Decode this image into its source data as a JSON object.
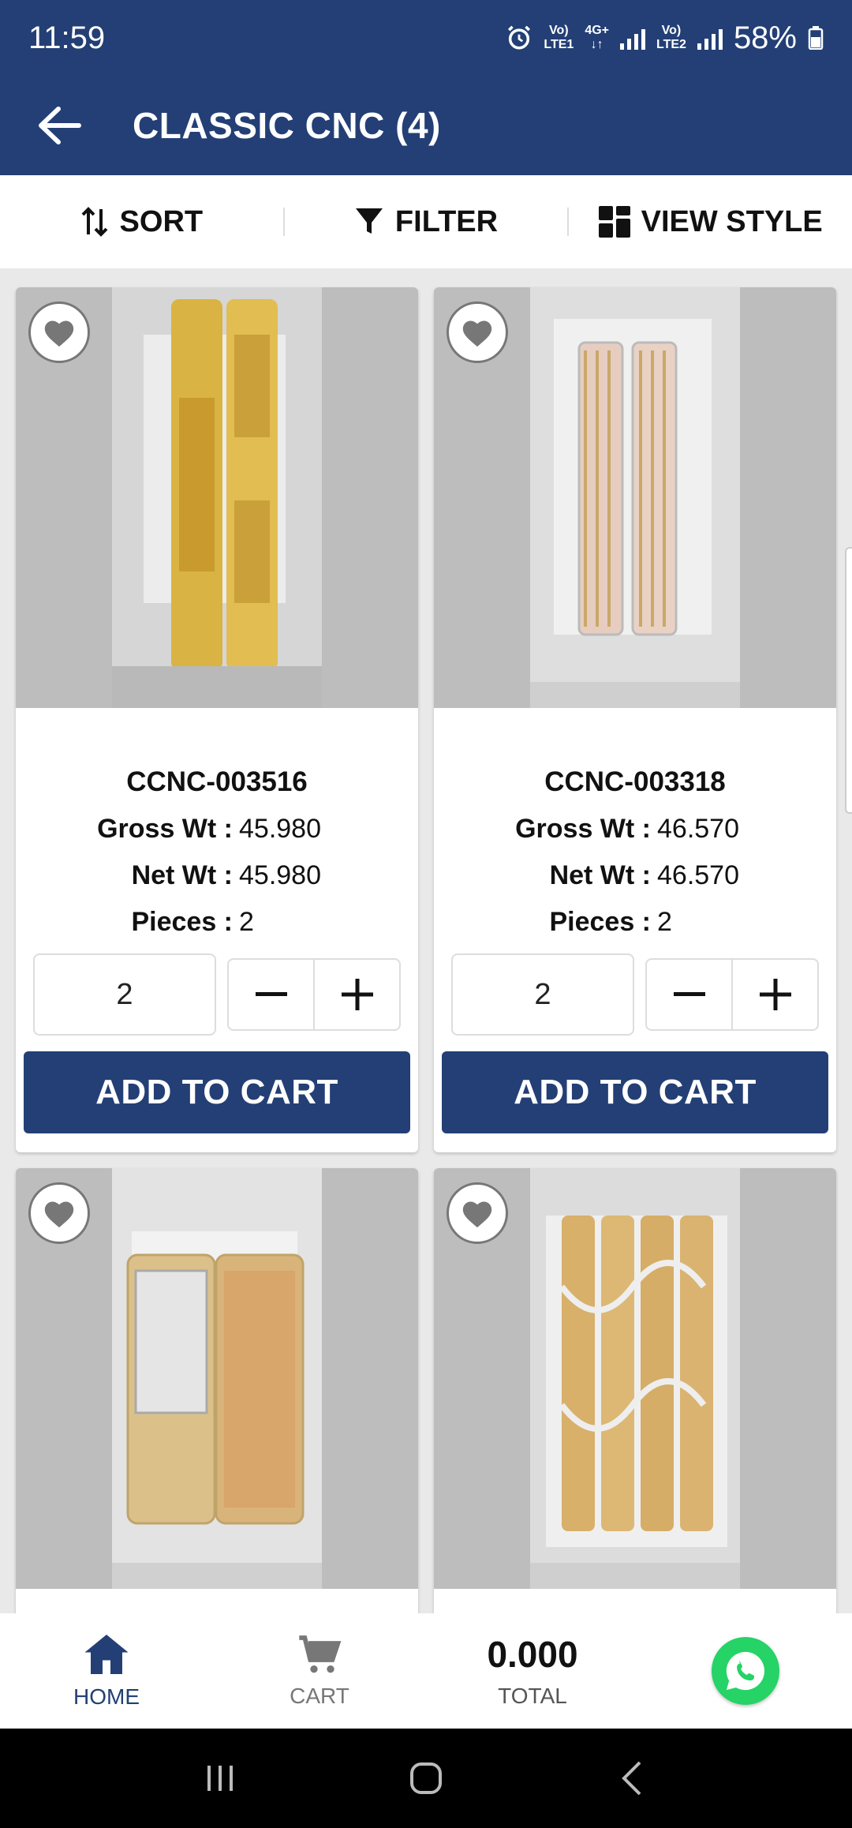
{
  "status": {
    "time": "11:59",
    "battery": "58%",
    "net1_top": "Vo)",
    "net1_bottom": "LTE1",
    "net_mid_top": "4G+",
    "net2_top": "Vo)",
    "net2_bottom": "LTE2"
  },
  "header": {
    "title": "CLASSIC CNC (4)"
  },
  "toolbar": {
    "sort": "SORT",
    "filter": "FILTER",
    "view_style": "VIEW STYLE"
  },
  "products": [
    {
      "code": "CCNC-003516",
      "gross_label": "Gross Wt :",
      "gross": "45.980",
      "net_label": "Net Wt :",
      "net": "45.980",
      "pieces_label": "Pieces :",
      "pieces": "2",
      "qty": "2",
      "add_label": "ADD TO CART"
    },
    {
      "code": "CCNC-003318",
      "gross_label": "Gross Wt :",
      "gross": "46.570",
      "net_label": "Net Wt :",
      "net": "46.570",
      "pieces_label": "Pieces :",
      "pieces": "2",
      "qty": "2",
      "add_label": "ADD TO CART"
    },
    {
      "code": "",
      "qty": ""
    },
    {
      "code": "",
      "qty": ""
    }
  ],
  "bottom_nav": {
    "home": "HOME",
    "cart": "CART",
    "total_value": "0.000",
    "total": "TOTAL"
  },
  "colors": {
    "primary": "#233f75",
    "whatsapp": "#25d366",
    "active_nav": "#233f75",
    "inactive_nav": "#777777"
  }
}
